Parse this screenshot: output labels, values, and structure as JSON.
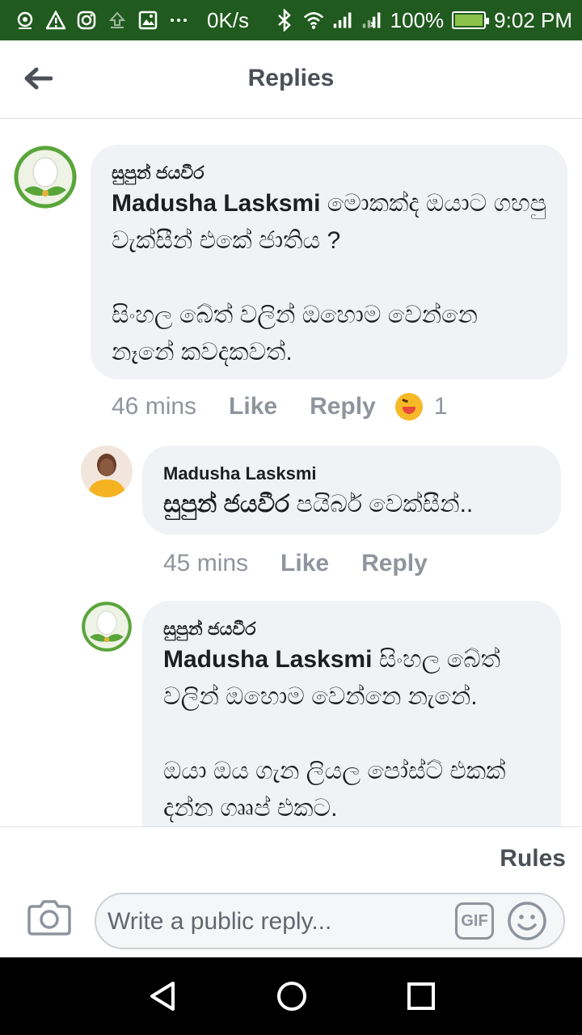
{
  "status_bar": {
    "speed": "0K/s",
    "battery": "100%",
    "battery_level": 1.0,
    "time": "9:02 PM",
    "icons": [
      "location-icon",
      "warning-icon",
      "instagram-icon",
      "upload-icon",
      "image-icon",
      "more-icon",
      "bluetooth-icon",
      "wifi-icon",
      "signal-icon",
      "signal-no-sim-icon",
      "battery-icon"
    ]
  },
  "header": {
    "title": "Replies"
  },
  "comments": [
    {
      "author": "සුපුන් ජයවීර",
      "mention": "Madusha Lasksmi",
      "text": " මොකක්ද ඔයාට ගහපු වැක්සීන් එකේ ජාතිය ?\n\nසිංහල බේත් වලින් ඔහොම වෙන්නෙ නෑනේ කවදකවත්.",
      "time": "46 mins",
      "like": "Like",
      "reply": "Reply",
      "reaction_count": "1"
    },
    {
      "author": "Madusha Lasksmi",
      "mention": "සුපුන් ජයවීර",
      "text": " පයිබර් වෙක්සීන්..",
      "time": "45 mins",
      "like": "Like",
      "reply": "Reply"
    },
    {
      "author": "සුපුන් ජයවීර",
      "mention": "Madusha Lasksmi",
      "text": " සිංහල බේත් වලින් ඔහොම වෙන්නෙ නැනේ.\n\nඔයා ඔය ගැන ලියල පෝස්ට් එකක් දන්න ගෲප් එකට."
    }
  ],
  "composer": {
    "rules": "Rules",
    "placeholder": "Write a public reply...",
    "gif": "GIF"
  },
  "colors": {
    "status_bar": "#205A1E",
    "bubble": "#f0f2f5",
    "meta_text": "#90949c",
    "title_text": "#4b4f56"
  }
}
